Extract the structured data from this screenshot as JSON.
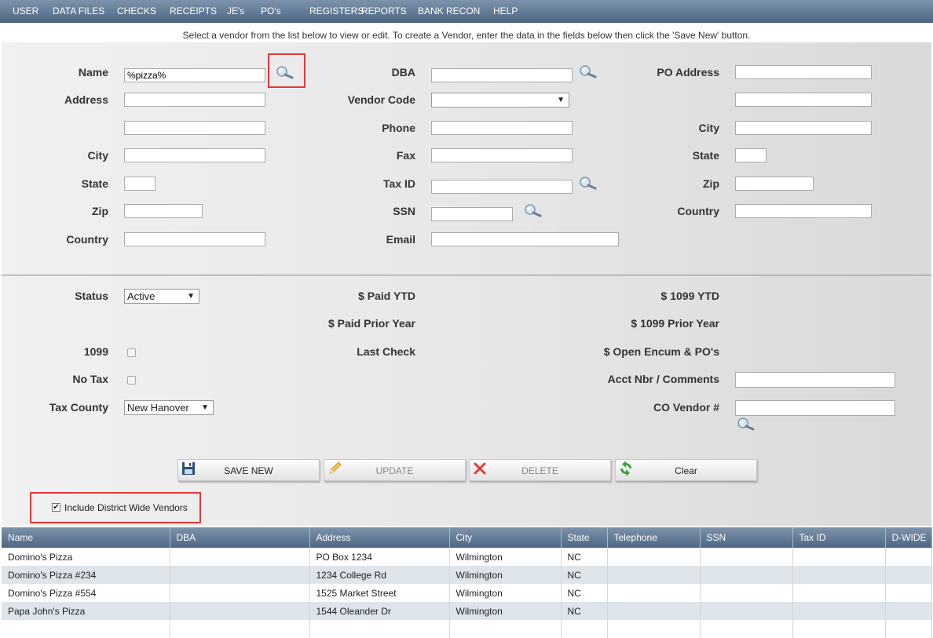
{
  "nav": [
    "USER",
    "DATA FILES",
    "CHECKS",
    "RECEIPTS",
    "JE's",
    "PO's",
    "REGISTERS",
    "REPORTS",
    "BANK RECON",
    "HELP"
  ],
  "instruction": "Select a vendor from the list below to view or edit. To create a Vendor, enter the data in the fields below then click the 'Save New' button.",
  "form": {
    "name_label": "Name",
    "name_value": "%pizza%",
    "address_label": "Address",
    "city_label": "City",
    "state_label": "State",
    "zip_label": "Zip",
    "country_label": "Country",
    "dba_label": "DBA",
    "vendor_code_label": "Vendor Code",
    "phone_label": "Phone",
    "fax_label": "Fax",
    "tax_id_label": "Tax ID",
    "ssn_label": "SSN",
    "email_label": "Email",
    "po_address_label": "PO Address",
    "po_city_label": "City",
    "po_state_label": "State",
    "po_zip_label": "Zip",
    "po_country_label": "Country"
  },
  "status": {
    "status_label": "Status",
    "status_value": "Active",
    "label_1099": "1099",
    "no_tax_label": "No Tax",
    "tax_county_label": "Tax County",
    "tax_county_value": "New Hanover",
    "paid_ytd": "$ Paid YTD",
    "paid_prior": "$ Paid Prior Year",
    "last_check": "Last Check",
    "ytd_1099": "$ 1099 YTD",
    "prior_1099": "$ 1099 Prior Year",
    "open_encum": "$ Open Encum & PO's",
    "acct_nbr": "Acct Nbr / Comments",
    "co_vendor": "CO Vendor #"
  },
  "buttons": {
    "save_new": "SAVE NEW",
    "update": "UPDATE",
    "delete": "DELETE",
    "clear": "Clear"
  },
  "include_district": "Include District Wide Vendors",
  "table": {
    "headers": [
      "Name",
      "DBA",
      "Address",
      "City",
      "State",
      "Telephone",
      "SSN",
      "Tax ID",
      "D-WIDE"
    ],
    "rows": [
      [
        "Domino's Pizza",
        "",
        "PO Box 1234",
        "Wilmington",
        "NC",
        "",
        "",
        "",
        ""
      ],
      [
        "Domino's Pizza #234",
        "",
        "1234 College Rd",
        "Wilmington",
        "NC",
        "",
        "",
        "",
        ""
      ],
      [
        "Domino's Pizza #554",
        "",
        "1525 Market Street",
        "Wilmington",
        "NC",
        "",
        "",
        "",
        ""
      ],
      [
        "Papa John's Pizza",
        "",
        "1544 Oleander Dr",
        "Wilmington",
        "NC",
        "",
        "",
        "",
        ""
      ],
      [
        "",
        "",
        "",
        "",
        "",
        "",
        "",
        "",
        ""
      ]
    ]
  },
  "colors": {
    "nav": "#5a7190",
    "highlight": "#e2393b",
    "row_alt": "#dde4ea"
  }
}
